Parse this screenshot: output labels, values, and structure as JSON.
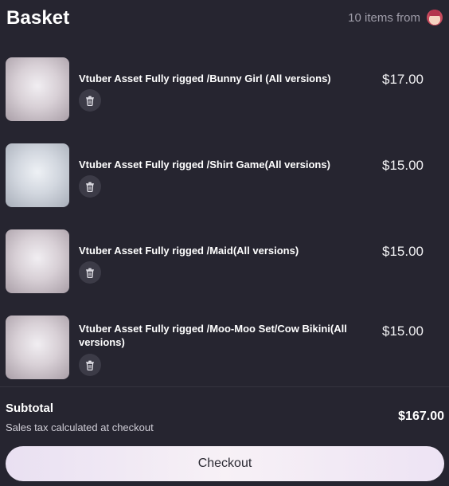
{
  "header": {
    "title": "Basket",
    "items_count_text": "10 items from",
    "seller_avatar_icon": "seller-avatar"
  },
  "items": [
    {
      "name": "Vtuber Asset Fully rigged /Bunny Girl (All versions)",
      "price": "$17.00",
      "delete_icon": "trash-icon"
    },
    {
      "name": "Vtuber Asset Fully rigged /Shirt Game(All versions)",
      "price": "$15.00",
      "delete_icon": "trash-icon"
    },
    {
      "name": "Vtuber Asset Fully rigged /Maid(All versions)",
      "price": "$15.00",
      "delete_icon": "trash-icon"
    },
    {
      "name": "Vtuber Asset Fully rigged /Moo-Moo Set/Cow Bikini(All versions)",
      "price": "$15.00",
      "delete_icon": "trash-icon"
    }
  ],
  "summary": {
    "subtotal_label": "Subtotal",
    "tax_note": "Sales tax calculated at checkout",
    "subtotal_value": "$167.00"
  },
  "checkout": {
    "label": "Checkout"
  },
  "colors": {
    "background": "#262530",
    "button_gradient_start": "#e9e0f2",
    "button_gradient_end": "#ede3f4"
  }
}
